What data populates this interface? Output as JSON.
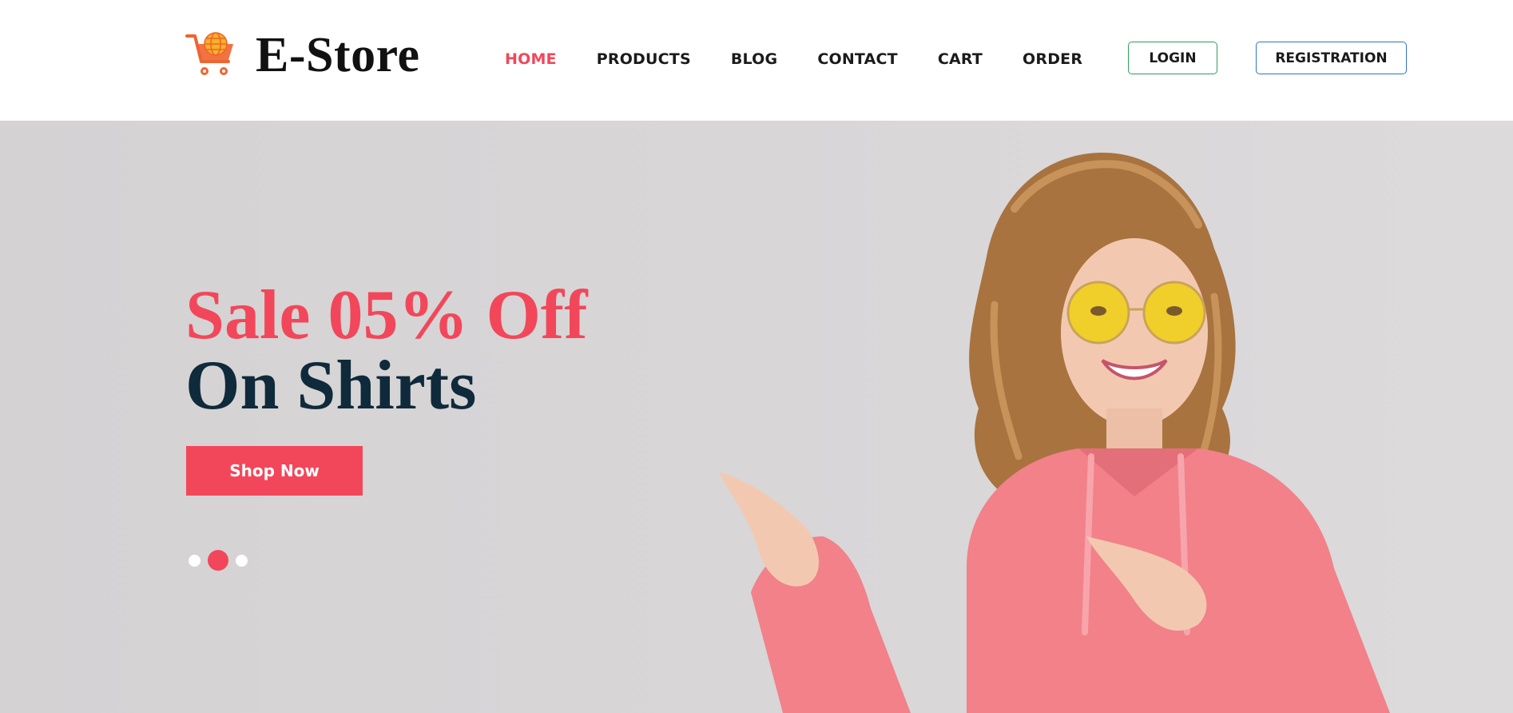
{
  "brand": {
    "name": "E-Store",
    "logo_icon": "shopping-cart-globe-icon",
    "logo_colors": [
      "#f0642f",
      "#f7b125"
    ]
  },
  "nav": {
    "items": [
      {
        "label": "HOME",
        "active": true
      },
      {
        "label": "PRODUCTS",
        "active": false
      },
      {
        "label": "BLOG",
        "active": false
      },
      {
        "label": "CONTACT",
        "active": false
      },
      {
        "label": "CART",
        "active": false
      },
      {
        "label": "ORDER",
        "active": false
      }
    ],
    "login_label": "LOGIN",
    "register_label": "REGISTRATION"
  },
  "hero": {
    "headline_line1": "Sale 05% Off",
    "headline_line2": "On Shirts",
    "cta_label": "Shop Now",
    "slides_count": 3,
    "active_slide": 2,
    "image_subject": "woman-pointing-photo"
  },
  "colors": {
    "accent": "#f2475a",
    "headline_dark": "#0f2a3a",
    "login_border": "#2e9e5b",
    "register_border": "#2f73c9",
    "hero_bg": "#d6d4d5"
  }
}
